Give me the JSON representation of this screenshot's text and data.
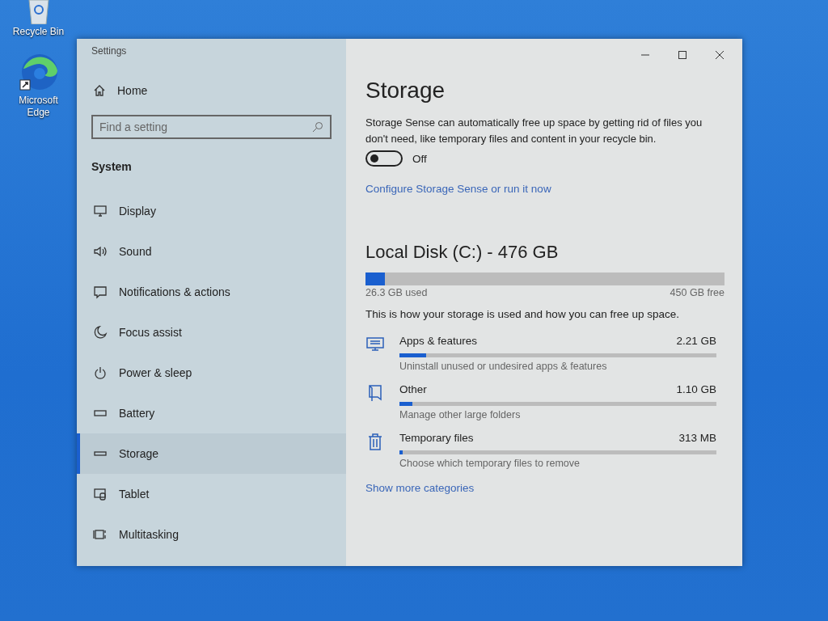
{
  "desktop_icons": [
    {
      "label": "Recycle Bin",
      "kind": "recycle"
    },
    {
      "label": "Microsoft Edge",
      "kind": "browser"
    }
  ],
  "window": {
    "title": "Settings"
  },
  "sidebar": {
    "home": "Home",
    "search": {
      "placeholder": "Find a setting"
    },
    "section": "System",
    "items": [
      {
        "label": "Display",
        "kind": "display",
        "selected": false
      },
      {
        "label": "Sound",
        "kind": "sound",
        "selected": false
      },
      {
        "label": "Notifications & actions",
        "kind": "notifications",
        "selected": false
      },
      {
        "label": "Focus assist",
        "kind": "focus",
        "selected": false
      },
      {
        "label": "Power & sleep",
        "kind": "power",
        "selected": false
      },
      {
        "label": "Battery",
        "kind": "battery",
        "selected": false
      },
      {
        "label": "Storage",
        "kind": "storage",
        "selected": true
      },
      {
        "label": "Tablet",
        "kind": "tablet",
        "selected": false
      },
      {
        "label": "Multitasking",
        "kind": "multitasking",
        "selected": false
      }
    ]
  },
  "content": {
    "title": "Storage",
    "description": "Storage Sense can automatically free up space by getting rid of files you don't need, like temporary files and content in your recycle bin.",
    "storage_sense": {
      "on": false,
      "label": "Off"
    },
    "configure_link": "Configure Storage Sense or run it now",
    "disk": {
      "title": "Local Disk (C:) - 476 GB",
      "level": 0.055,
      "used": "26.3 GB used",
      "free": "450 GB free"
    },
    "usage_intro": "This is how your storage is used and how you can free up space.",
    "categories": [
      {
        "kind": "apps",
        "name": "Apps & features",
        "size": "2.21 GB",
        "level": 0.085,
        "hint": "Uninstall unused or undesired apps & features"
      },
      {
        "kind": "other",
        "name": "Other",
        "size": "1.10 GB",
        "level": 0.04,
        "hint": "Manage other large folders"
      },
      {
        "kind": "temp",
        "name": "Temporary files",
        "size": "313 MB",
        "level": 0.01,
        "hint": "Choose which temporary files to remove"
      }
    ],
    "more_link": "Show more categories"
  }
}
